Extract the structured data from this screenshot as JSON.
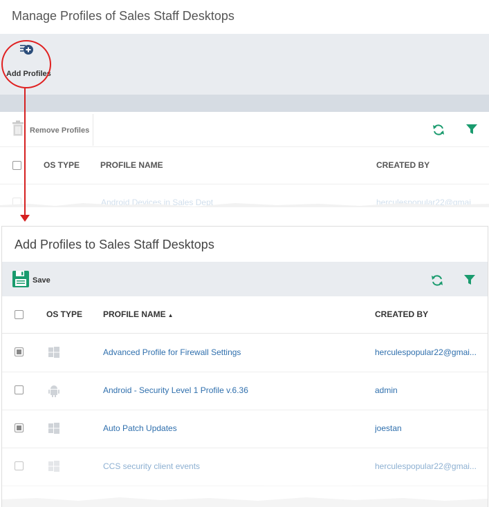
{
  "top_panel": {
    "title": "Manage Profiles of Sales Staff Desktops",
    "add_profiles_label": "Add Profiles",
    "remove_profiles_label": "Remove Profiles",
    "columns": {
      "os_type": "OS TYPE",
      "profile_name": "PROFILE NAME",
      "created_by": "CREATED BY"
    },
    "partial_row": {
      "profile_name": "Android Devices in Sales Dept",
      "created_by": "herculespopular22@gmai"
    }
  },
  "bottom_panel": {
    "title": "Add Profiles to Sales Staff Desktops",
    "save_label": "Save",
    "columns": {
      "os_type": "OS TYPE",
      "profile_name": "PROFILE NAME",
      "created_by": "CREATED BY"
    },
    "rows": [
      {
        "checked": true,
        "os": "windows-icon",
        "profile_name": "Advanced Profile for Firewall Settings",
        "created_by": "herculespopular22@gmai..."
      },
      {
        "checked": false,
        "os": "android-icon",
        "profile_name": "Android - Security Level 1 Profile v.6.36",
        "created_by": "admin"
      },
      {
        "checked": true,
        "os": "windows-icon",
        "profile_name": "Auto Patch Updates",
        "created_by": "joestan"
      },
      {
        "checked": false,
        "os": "windows-icon",
        "profile_name": "CCS security client events",
        "created_by": "herculespopular22@gmai..."
      }
    ]
  },
  "colors": {
    "accent_green": "#1a9b6e",
    "annotation_red": "#d62020",
    "link_blue": "#2f6fad",
    "toolbar_bg": "#e9ecf0"
  }
}
